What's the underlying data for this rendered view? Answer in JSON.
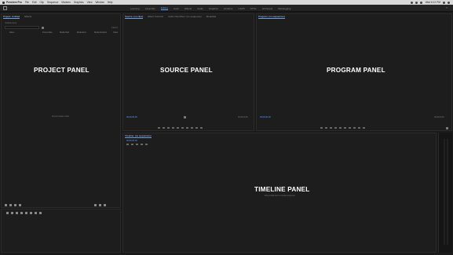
{
  "menubar": {
    "app_name": "Premiere Pro",
    "items": [
      "File",
      "Edit",
      "Clip",
      "Sequence",
      "Markers",
      "Graphics",
      "View",
      "Window",
      "Help"
    ],
    "clock": "Wed 6:12 PM"
  },
  "workspace_tabs": [
    "Learning",
    "Assembly",
    "Editing",
    "Color",
    "Effects",
    "Audio",
    "Graphics",
    "Libraries",
    "CAPS",
    "NTSC",
    "All Panels",
    "Metalogging"
  ],
  "workspace_active_index": 2,
  "project_panel": {
    "tabs": [
      "Project: Untitled",
      "Effects"
    ],
    "active_tab": 0,
    "project_file": "Untitled.prproj",
    "item_count": "0 Items",
    "columns": [
      "Name",
      "Frame Rate",
      "Media Start",
      "Media End",
      "Media Duration",
      "Video"
    ],
    "empty_hint": "Import media to start",
    "label": "PROJECT PANEL"
  },
  "source_panel": {
    "tabs": [
      "Source: (no clips)",
      "Effect Controls",
      "Audio Clip Mixer: (no sequence)",
      "Metadata"
    ],
    "active_tab": 0,
    "timecode_left": "00;00;00;00",
    "timecode_right": "00;00;00;00",
    "label": "SOURCE PANEL"
  },
  "program_panel": {
    "tabs": [
      "Program: (no sequences)"
    ],
    "active_tab": 0,
    "timecode_left": "00;00;00;00",
    "timecode_right": "00;00;00;00",
    "label": "PROGRAM PANEL"
  },
  "timeline_panel": {
    "tabs": [
      "Timeline: (no sequences)"
    ],
    "active_tab": 0,
    "timecode": "00;00;00;00",
    "drop_hint": "Drop media here to create sequence.",
    "label": "TIMELINE PANEL"
  },
  "accent_color": "#5aa0ff"
}
